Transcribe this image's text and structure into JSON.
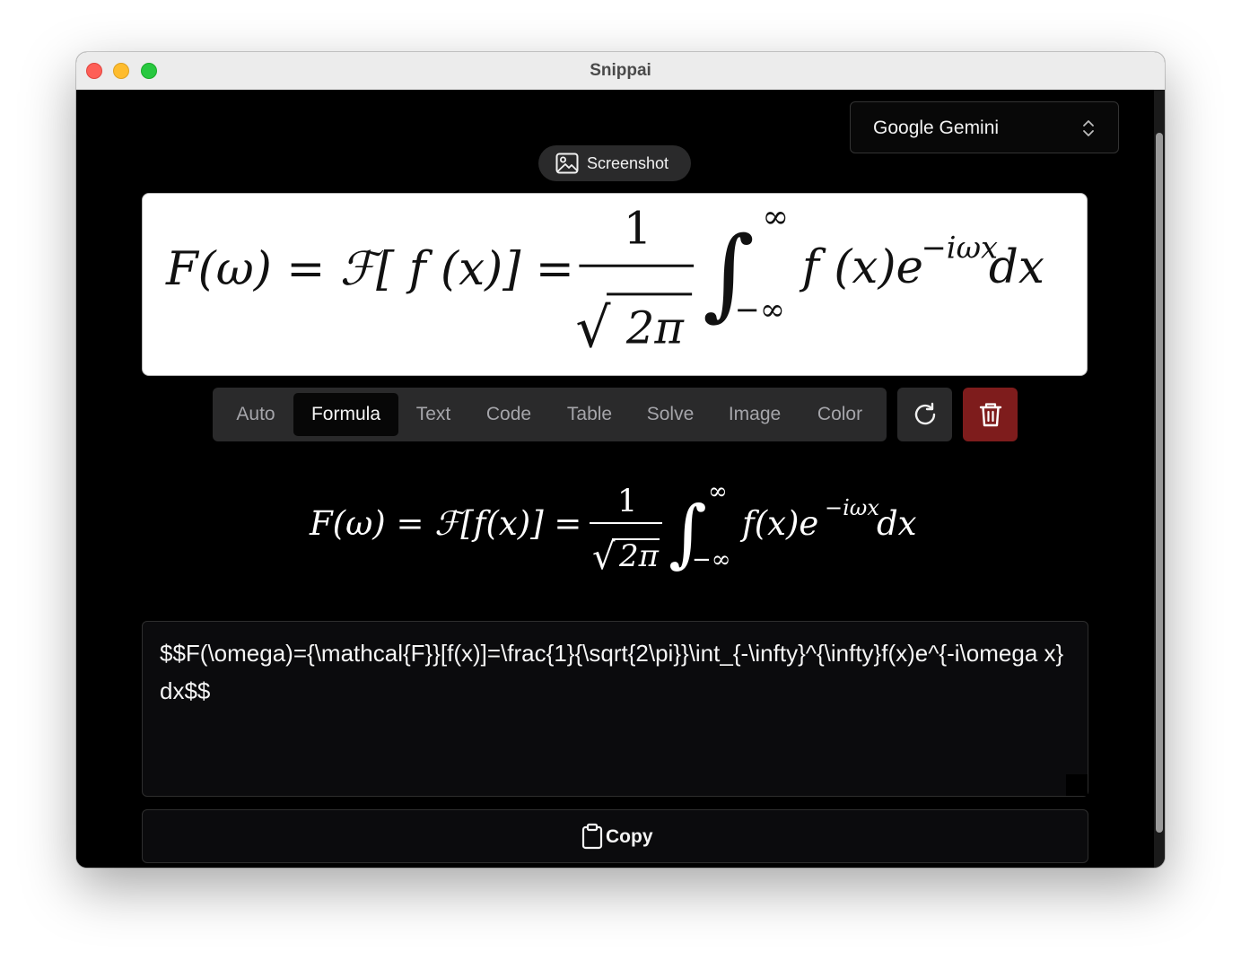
{
  "window": {
    "title": "Snippai"
  },
  "model_select": {
    "value": "Google Gemini",
    "icon": "chevron-up-down-icon"
  },
  "screenshot_button": {
    "label": "Screenshot",
    "icon": "image-icon"
  },
  "preview": {
    "formula_parts": {
      "lhs": "F(ω) = ℱ[ f (x)] =",
      "numerator": "1",
      "radical": "√",
      "radicand": "2π",
      "integral": "∫",
      "upper": "∞",
      "lower": "−∞",
      "body": "f (x)e",
      "exponent": "−iωx",
      "dx": "dx"
    }
  },
  "modes": {
    "items": [
      {
        "label": "Auto",
        "active": false
      },
      {
        "label": "Formula",
        "active": true
      },
      {
        "label": "Text",
        "active": false
      },
      {
        "label": "Code",
        "active": false
      },
      {
        "label": "Table",
        "active": false
      },
      {
        "label": "Solve",
        "active": false
      },
      {
        "label": "Image",
        "active": false
      },
      {
        "label": "Color",
        "active": false
      }
    ]
  },
  "actions": {
    "refresh_icon": "refresh-icon",
    "delete_icon": "trash-icon",
    "delete_color": "#7e1c1c"
  },
  "rendered": {
    "lhs": "F(ω) = ℱ[f(x)] =",
    "numerator": "1",
    "radical": "√",
    "radicand": "2π",
    "integral": "∫",
    "upper": "∞",
    "lower": "−∞",
    "body": "f(x)e",
    "exponent": "−iωx",
    "dx": "dx"
  },
  "latex": {
    "value": "$$F(\\omega)={\\mathcal{F}}[f(x)]=\\frac{1}{\\sqrt{2\\pi}}\\int_{-\\infty}^{\\infty}f(x)e^{-i\\omega x}dx$$"
  },
  "copy_button": {
    "label": "Copy",
    "icon": "clipboard-icon"
  }
}
